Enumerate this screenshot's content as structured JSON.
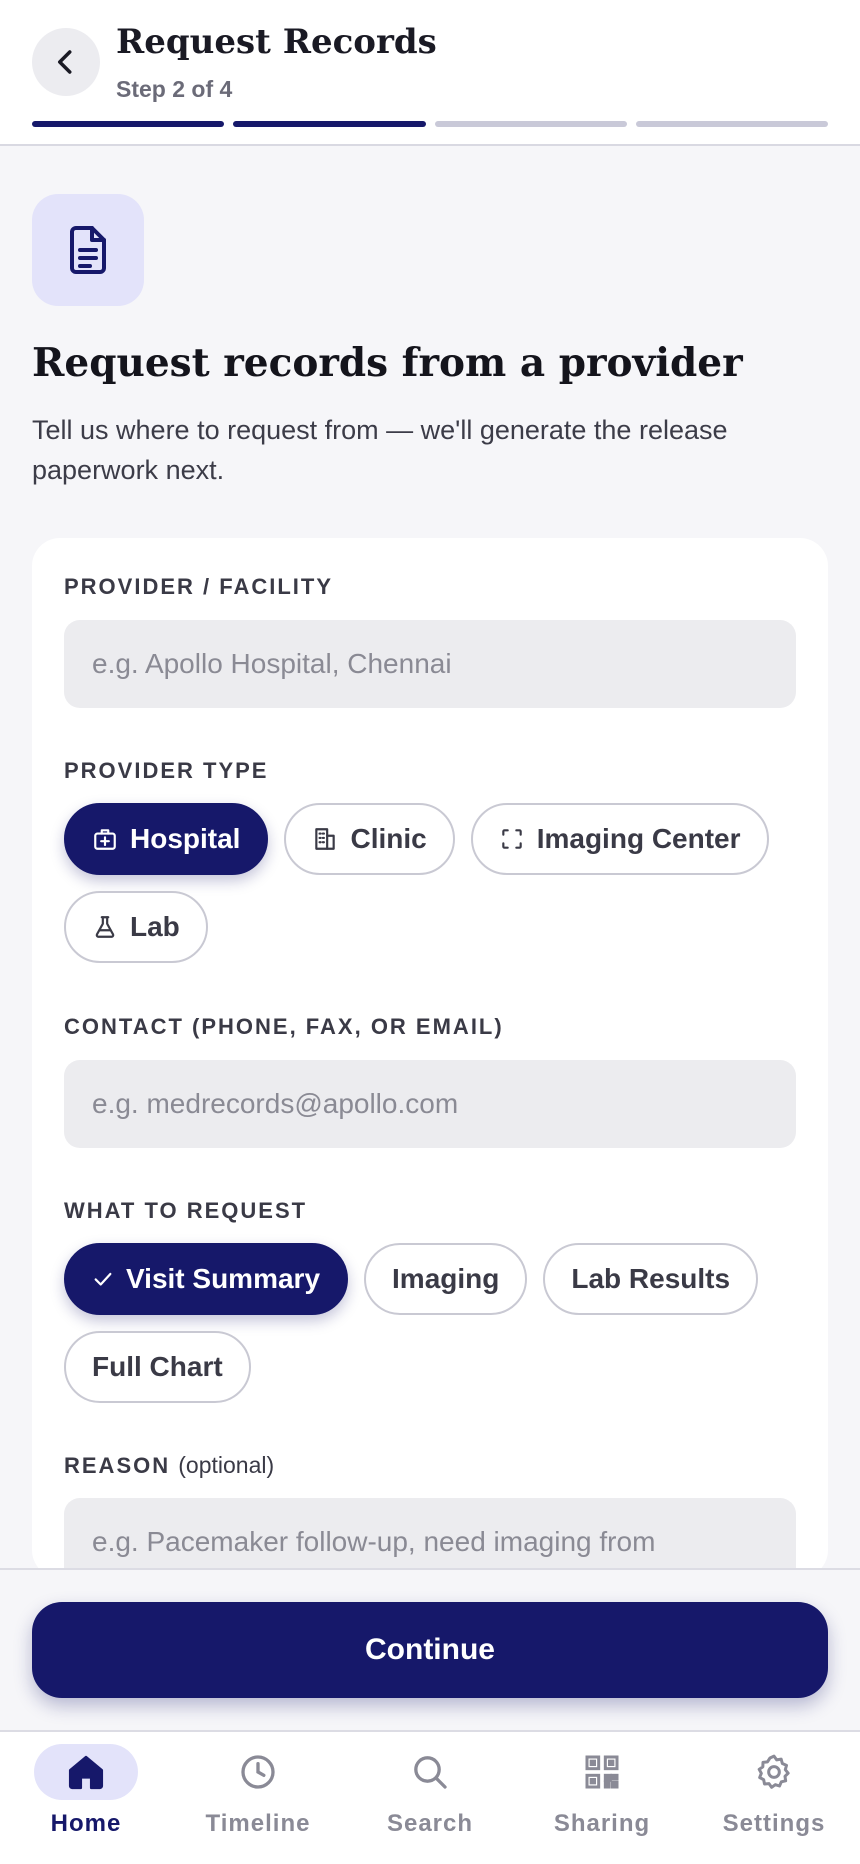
{
  "header": {
    "title": "Request Records",
    "step": "Step 2 of 4",
    "progress": {
      "total": 4,
      "completed": 2
    }
  },
  "hero": {
    "icon": "document-icon",
    "title": "Request records from a provider",
    "subtitle": "Tell us where to request from — we'll generate the release paperwork next."
  },
  "form": {
    "provider": {
      "label": "PROVIDER / FACILITY",
      "placeholder": "e.g. Apollo Hospital, Chennai",
      "value": ""
    },
    "provider_type": {
      "label": "PROVIDER TYPE",
      "options": [
        {
          "label": "Hospital",
          "icon": "hospital-icon",
          "selected": true
        },
        {
          "label": "Clinic",
          "icon": "building-icon",
          "selected": false
        },
        {
          "label": "Imaging Center",
          "icon": "scan-icon",
          "selected": false
        },
        {
          "label": "Lab",
          "icon": "flask-icon",
          "selected": false
        }
      ]
    },
    "contact": {
      "label": "CONTACT (PHONE, FAX, OR EMAIL)",
      "placeholder": "e.g. medrecords@apollo.com",
      "value": ""
    },
    "request_items": {
      "label": "WHAT TO REQUEST",
      "options": [
        {
          "label": "Visit Summary",
          "selected": true
        },
        {
          "label": "Imaging",
          "selected": false
        },
        {
          "label": "Lab Results",
          "selected": false
        },
        {
          "label": "Full Chart",
          "selected": false
        }
      ]
    },
    "reason": {
      "label": "REASON",
      "optional": "(optional)",
      "placeholder": "e.g. Pacemaker follow-up, need imaging from",
      "value": ""
    }
  },
  "continue_label": "Continue",
  "nav": {
    "items": [
      {
        "label": "Home",
        "icon": "home-icon",
        "active": true
      },
      {
        "label": "Timeline",
        "icon": "clock-icon",
        "active": false
      },
      {
        "label": "Search",
        "icon": "search-icon",
        "active": false
      },
      {
        "label": "Sharing",
        "icon": "qr-code-icon",
        "active": false
      },
      {
        "label": "Settings",
        "icon": "gear-icon",
        "active": false
      }
    ]
  },
  "colors": {
    "primary": "#16186a",
    "accent_soft": "#e3e3fa",
    "background": "#f6f6f9"
  }
}
